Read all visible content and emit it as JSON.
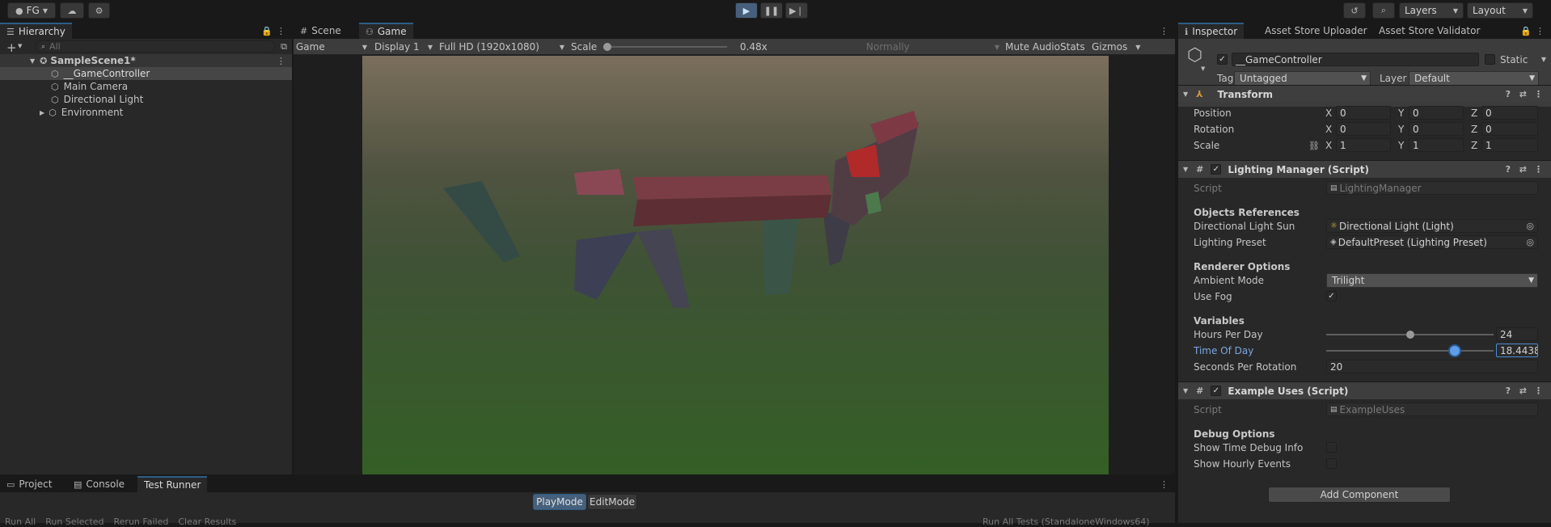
{
  "toolbar": {
    "account": "FG",
    "layers": "Layers",
    "layout": "Layout"
  },
  "hierarchy": {
    "tab": "Hierarchy",
    "search_placeholder": "All",
    "scene": "SampleScene1*",
    "items": [
      "__GameController",
      "Main Camera",
      "Directional Light",
      "Environment"
    ]
  },
  "game": {
    "tabs": [
      "Scene",
      "Game"
    ],
    "view_mode": "Game",
    "display": "Display 1",
    "resolution": "Full HD (1920x1080)",
    "scale_label": "Scale",
    "scale_value": "0.48x",
    "play_focus": "Normally",
    "mute": "Mute Audio",
    "stats": "Stats",
    "gizmos": "Gizmos"
  },
  "inspector": {
    "tabs": [
      "Inspector",
      "Asset Store Uploader",
      "Asset Store Validator"
    ],
    "object_name": "__GameController",
    "static_label": "Static",
    "tag_label": "Tag",
    "tag_value": "Untagged",
    "layer_label": "Layer",
    "layer_value": "Default",
    "transform": {
      "title": "Transform",
      "rows": [
        {
          "label": "Position",
          "x": "0",
          "y": "0",
          "z": "0"
        },
        {
          "label": "Rotation",
          "x": "0",
          "y": "0",
          "z": "0"
        },
        {
          "label": "Scale",
          "x": "1",
          "y": "1",
          "z": "1"
        }
      ],
      "axes": [
        "X",
        "Y",
        "Z"
      ]
    },
    "lighting": {
      "title": "Lighting Manager (Script)",
      "script_label": "Script",
      "script_value": "LightingManager",
      "objects_refs": "Objects References",
      "sun_label": "Directional Light Sun",
      "sun_value": "Directional Light (Light)",
      "preset_label": "Lighting Preset",
      "preset_value": "DefaultPreset (Lighting Preset)",
      "renderer_options": "Renderer Options",
      "ambient_label": "Ambient Mode",
      "ambient_value": "Trilight",
      "fog_label": "Use Fog",
      "variables": "Variables",
      "hours_label": "Hours Per Day",
      "hours_value": "24",
      "hours_level": 0.5,
      "time_label": "Time Of Day",
      "time_value": "18.4438",
      "time_level": 0.77,
      "seconds_label": "Seconds Per Rotation",
      "seconds_value": "20"
    },
    "example": {
      "title": "Example Uses (Script)",
      "script_label": "Script",
      "script_value": "ExampleUses",
      "debug_options": "Debug Options",
      "debug_time_label": "Show Time Debug Info",
      "hourly_label": "Show Hourly Events"
    },
    "add_component": "Add Component"
  },
  "bottom": {
    "tabs": [
      "Project",
      "Console",
      "Test Runner"
    ],
    "playmode": "PlayMode",
    "editmode": "EditMode",
    "actions": [
      "Run All",
      "Run Selected",
      "Rerun Failed",
      "Clear Results"
    ],
    "run_all_tests": "Run All Tests (StandaloneWindows64)"
  },
  "colors": {
    "accent": "#2c5d87",
    "play_active": "#46607c",
    "highlight_label": "#7ba7e0"
  }
}
